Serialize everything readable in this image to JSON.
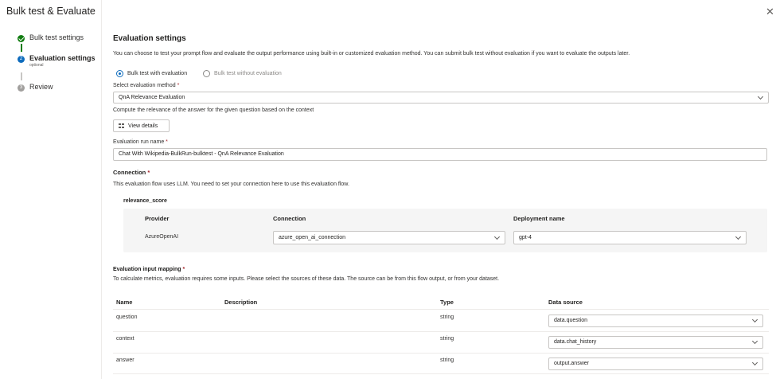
{
  "dialog": {
    "title": "Bulk test & Evaluate",
    "close_label": "✕"
  },
  "stepper": {
    "steps": [
      {
        "label": "Bulk test settings",
        "status": "done"
      },
      {
        "label": "Evaluation settings",
        "sub": "optional",
        "status": "current",
        "number": "2"
      },
      {
        "label": "Review",
        "status": "todo",
        "number": "3"
      }
    ]
  },
  "main": {
    "title": "Evaluation settings",
    "description": "You can choose to test your prompt flow and evaluate the output performance using built-in or customized evaluation method. You can submit bulk test without evaluation if you want to evaluate the outputs later.",
    "radio": {
      "with_eval": "Bulk test with evaluation",
      "without_eval": "Bulk test without evaluation",
      "selected": "with_eval"
    },
    "method": {
      "label": "Select evaluation method",
      "required": "*",
      "value": "QnA Relevance Evaluation",
      "description": "Compute the relevance of the answer for the given question based on the context"
    },
    "view_details_label": "View details",
    "run_name": {
      "label": "Evaluation run name",
      "required": "*",
      "value": "Chat With Wikipedia-BulkRun-bulktest - QnA Relevance Evaluation"
    },
    "connection": {
      "label": "Connection",
      "required": "*",
      "description": "This evaluation flow uses LLM. You need to set your connection here to use this evaluation flow.",
      "node_name": "relevance_score",
      "headers": {
        "provider": "Provider",
        "connection": "Connection",
        "deployment": "Deployment name"
      },
      "row": {
        "provider": "AzureOpenAI",
        "connection": "azure_open_ai_connection",
        "deployment": "gpt-4"
      }
    },
    "mapping": {
      "label": "Evaluation input mapping",
      "required": "*",
      "description": "To calculate metrics, evaluation requires some inputs. Please select the sources of these data. The source can be from this flow output, or from your dataset.",
      "headers": {
        "name": "Name",
        "description": "Description",
        "type": "Type",
        "source": "Data source"
      },
      "rows": [
        {
          "name": "question",
          "description": "",
          "type": "string",
          "source": "data.question"
        },
        {
          "name": "context",
          "description": "",
          "type": "string",
          "source": "data.chat_history"
        },
        {
          "name": "answer",
          "description": "",
          "type": "string",
          "source": "output.answer"
        }
      ]
    }
  },
  "colors": {
    "accent": "#0f6cbd",
    "success": "#107c10",
    "required": "#a4262c"
  }
}
